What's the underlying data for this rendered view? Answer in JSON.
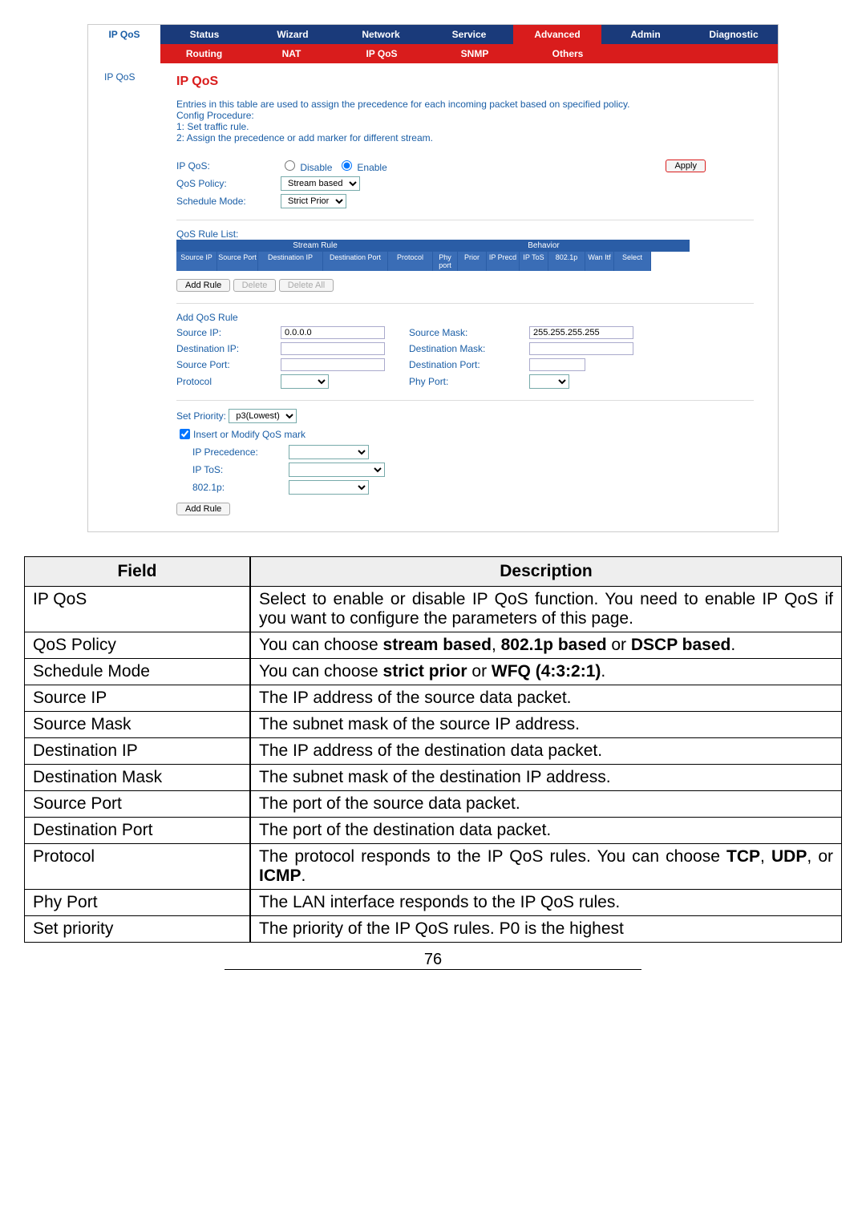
{
  "sidebar_main": "IP QoS",
  "sidebar_sub": "IP QoS",
  "tabs_main": [
    "Status",
    "Wizard",
    "Network",
    "Service",
    "Advanced",
    "Admin",
    "Diagnostic"
  ],
  "tabs_sub": [
    "Routing",
    "NAT",
    "IP QoS",
    "SNMP",
    "Others"
  ],
  "page_title": "IP QoS",
  "intro": [
    "Entries in this table are used to assign the precedence for each incoming packet based on specified policy.",
    "Config Procedure:",
    "1: Set traffic rule.",
    "2: Assign the precedence or add marker for different stream."
  ],
  "labels": {
    "ip_qos": "IP QoS:",
    "disable": "Disable",
    "enable": "Enable",
    "apply": "Apply",
    "qos_policy": "QoS Policy:",
    "stream_based": "Stream based",
    "schedule_mode": "Schedule Mode:",
    "strict_prior": "Strict Prior",
    "qos_rule_list": "QoS Rule List:",
    "stream_rule": "Stream Rule",
    "behavior": "Behavior",
    "add_rule": "Add Rule",
    "delete": "Delete",
    "delete_all": "Delete All",
    "add_qos_rule": "Add QoS Rule",
    "source_ip": "Source IP:",
    "source_mask": "Source Mask:",
    "dest_ip": "Destination IP:",
    "dest_mask": "Destination Mask:",
    "source_port": "Source Port:",
    "dest_port": "Destination Port:",
    "protocol": "Protocol",
    "phy_port": "Phy Port:",
    "set_priority": "Set Priority:",
    "p3_lowest": "p3(Lowest)",
    "insert_modify": "Insert or Modify QoS mark",
    "ip_precedence": "IP Precedence:",
    "ip_tos": "IP ToS:",
    "8021p": "802.1p:"
  },
  "values": {
    "source_ip": "0.0.0.0",
    "source_mask": "255.255.255.255"
  },
  "rule_cols": [
    "Source IP",
    "Source Port",
    "Destination IP",
    "Destination Port",
    "Protocol",
    "Phy port",
    "Prior",
    "IP Precd",
    "IP ToS",
    "802.1p",
    "Wan Itf",
    "Select"
  ],
  "table_header": {
    "field": "Field",
    "desc": "Description"
  },
  "table_rows": [
    {
      "field": "IP QoS",
      "desc": "Select to enable or disable IP QoS function. You need to enable IP QoS if you want to configure the parameters of this page."
    },
    {
      "field": "QoS Policy",
      "desc": "You can choose <b>stream based</b>, <b>802.1p based</b> or <b>DSCP based</b>."
    },
    {
      "field": "Schedule Mode",
      "desc": "You can choose <b>strict prior</b> or <b>WFQ (4:3:2:1)</b>."
    },
    {
      "field": "Source IP",
      "desc": "The IP address of the source data packet."
    },
    {
      "field": "Source Mask",
      "desc": "The subnet mask of the source IP address."
    },
    {
      "field": "Destination IP",
      "desc": "The IP address of the destination data packet."
    },
    {
      "field": "Destination Mask",
      "desc": "The subnet mask of the destination IP address."
    },
    {
      "field": "Source Port",
      "desc": "The port of the source data packet."
    },
    {
      "field": "Destination Port",
      "desc": "The port of the destination data packet."
    },
    {
      "field": "Protocol",
      "desc": "The protocol responds to the IP QoS rules. You can choose <b>TCP</b>, <b>UDP</b>, or <b>ICMP</b>."
    },
    {
      "field": "Phy Port",
      "desc": "The LAN interface responds to the IP QoS rules."
    },
    {
      "field": "Set priority",
      "desc": "The priority of the IP QoS rules. P0 is the highest"
    }
  ],
  "page_number": "76"
}
